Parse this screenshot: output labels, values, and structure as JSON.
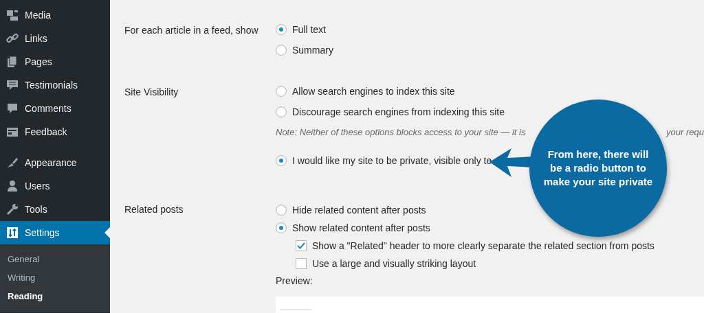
{
  "sidebar": {
    "items": [
      {
        "label": "Media",
        "selected": false
      },
      {
        "label": "Links",
        "selected": false
      },
      {
        "label": "Pages",
        "selected": false
      },
      {
        "label": "Testimonials",
        "selected": false
      },
      {
        "label": "Comments",
        "selected": false
      },
      {
        "label": "Feedback",
        "selected": false
      },
      {
        "label": "Appearance",
        "selected": false
      },
      {
        "label": "Users",
        "selected": false
      },
      {
        "label": "Tools",
        "selected": false
      },
      {
        "label": "Settings",
        "selected": true
      }
    ],
    "submenu": [
      {
        "label": "General",
        "selected": false
      },
      {
        "label": "Writing",
        "selected": false
      },
      {
        "label": "Reading",
        "selected": true
      }
    ]
  },
  "settings": [
    {
      "label": "For each article in a feed, show",
      "controls": [
        {
          "kind": "radio",
          "label": "Full text",
          "selected": true
        },
        {
          "kind": "radio",
          "label": "Summary",
          "selected": false
        }
      ]
    },
    {
      "label": "Site Visibility",
      "controls": [
        {
          "kind": "radio",
          "label": "Allow search engines to index this site",
          "selected": false
        },
        {
          "kind": "radio",
          "label": "Discourage search engines from indexing this site",
          "selected": false
        },
        {
          "kind": "note",
          "parts": [
            "Note: Neither of these options blocks access to your site — it is",
            "your requ"
          ]
        },
        {
          "kind": "radio",
          "label": "I would like my site to be private, visible only te",
          "selected": true
        }
      ]
    },
    {
      "label": "Related posts",
      "controls": [
        {
          "kind": "radio",
          "label": "Hide related content after posts",
          "selected": false
        },
        {
          "kind": "radio",
          "label": "Show related content after posts",
          "selected": true
        },
        {
          "kind": "checkbox",
          "label": "Show a \"Related\" header to more clearly separate the related section from posts",
          "checked": true
        },
        {
          "kind": "checkbox",
          "label": "Use a large and visually striking layout",
          "checked": false
        },
        {
          "kind": "preview",
          "label": "Preview:"
        }
      ]
    }
  ],
  "callout": {
    "text": "From here, there will be a radio button to make your site private"
  }
}
